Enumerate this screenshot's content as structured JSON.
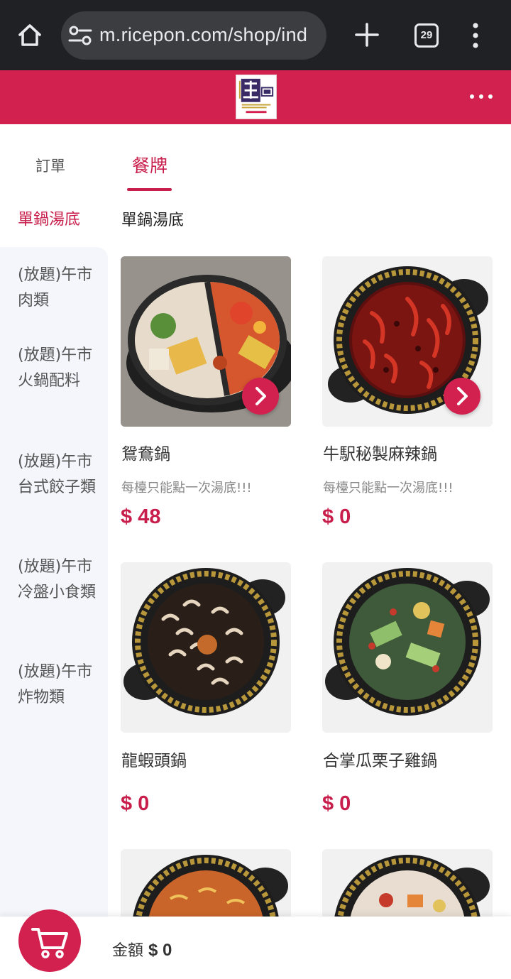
{
  "browser": {
    "url": "m.ricepon.com/shop/ind",
    "tab_count": "29"
  },
  "shop": {
    "logo_icon": "niu-zhan-logo"
  },
  "tabs": [
    {
      "label": "訂單",
      "active": false
    },
    {
      "label": "餐牌",
      "active": true
    }
  ],
  "categories": [
    {
      "label": "單鍋湯底",
      "active": true
    },
    {
      "label": "(放題)午市肉類",
      "active": false
    },
    {
      "label": "(放題)午市火鍋配料",
      "active": false
    },
    {
      "label": "(放題)午市台式餃子類",
      "active": false
    },
    {
      "label": "(放題)午市冷盤小食類",
      "active": false
    },
    {
      "label": "(放題)午市炸物類",
      "active": false
    }
  ],
  "section": {
    "title": "單鍋湯底"
  },
  "items": [
    {
      "name": "鴛鴦鍋",
      "note": "每檯只能點一次湯底!!!",
      "price": "$ 48",
      "image": "yuanyang-hotpot"
    },
    {
      "name": "牛駅秘製麻辣鍋",
      "note": "每檯只能點一次湯底!!!",
      "price": "$ 0",
      "image": "mala-hotpot"
    },
    {
      "name": "龍蝦頭鍋",
      "note": "",
      "price": "$ 0",
      "image": "lobster-head-hotpot"
    },
    {
      "name": "合掌瓜栗子雞鍋",
      "note": "",
      "price": "$ 0",
      "image": "chayote-chestnut-chicken-hotpot"
    }
  ],
  "cart": {
    "total_label": "金額",
    "total_amount": "$ 0"
  },
  "colors": {
    "brand": "#d2204f",
    "chrome": "#202124",
    "sidebar": "#f4f6fc"
  }
}
